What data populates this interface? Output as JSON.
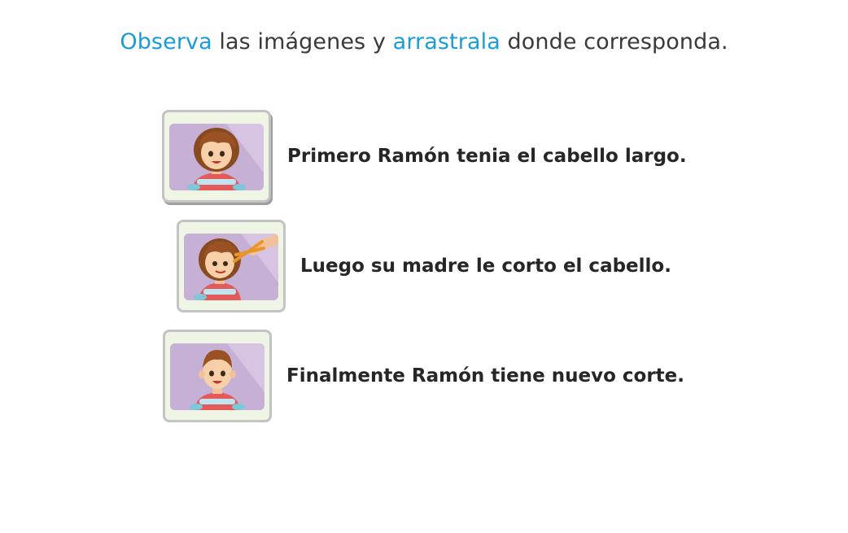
{
  "instruction": {
    "part1": "Observa",
    "part2": " las imágenes y ",
    "part3": "arrastrala",
    "part4": " donde corresponda."
  },
  "colors": {
    "highlight": "#1a9cd8",
    "text": "#3a3a3a",
    "card_bg": "#eef5e4",
    "card_border": "#c3c3c3",
    "picture_bg": "#c6b0d6"
  },
  "items": [
    {
      "label": "Primero Ramón tenia el cabello largo.",
      "image": "boy-long-hair"
    },
    {
      "label": "Luego su madre le corto el cabello.",
      "image": "boy-haircut-scissors"
    },
    {
      "label": "Finalmente Ramón tiene nuevo corte.",
      "image": "boy-short-hair"
    }
  ]
}
